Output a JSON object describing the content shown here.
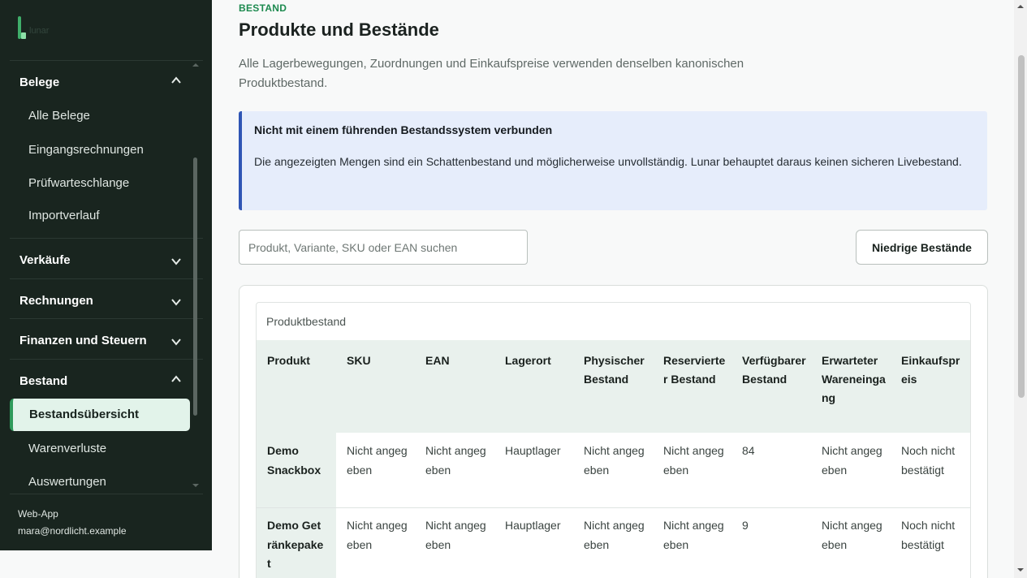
{
  "brand": {
    "name": "lunar",
    "icon": "lunar-logo-icon"
  },
  "sidebar": {
    "sections": [
      {
        "label": "Belege",
        "expanded": true,
        "items": [
          "Alle Belege",
          "Eingangsrechnungen",
          "Prüfwarteschlange",
          "Importverlauf"
        ]
      },
      {
        "label": "Verkäufe",
        "expanded": false
      },
      {
        "label": "Rechnungen",
        "expanded": false
      },
      {
        "label": "Finanzen und Steuern",
        "expanded": false
      },
      {
        "label": "Bestand",
        "expanded": true,
        "items": [
          "Bestandsübersicht",
          "Warenverluste",
          "Auswertungen"
        ]
      }
    ],
    "active_item": "Bestandsübersicht",
    "footer": {
      "app": "Web-App",
      "email": "mara@nordlicht.example"
    }
  },
  "page": {
    "eyebrow": "BESTAND",
    "title": "Produkte und Bestände",
    "lead": "Alle Lagerbewegungen, Zuordnungen und Einkaufspreise verwenden denselben kanonischen Produktbestand."
  },
  "notice": {
    "title": "Nicht mit einem führenden Bestandssystem verbunden",
    "body": "Die angezeigten Mengen sind ein Schattenbestand und möglicherweise unvollständig. Lunar behauptet daraus keinen sicheren Livebestand."
  },
  "search": {
    "placeholder": "Produkt, Variante, SKU oder EAN suchen",
    "value": ""
  },
  "low_stock_button": "Niedrige Bestände",
  "table": {
    "caption": "Produktbestand",
    "columns": [
      "Produkt",
      "SKU",
      "EAN",
      "Lagerort",
      "Physischer Bestand",
      "Reservierter Bestand",
      "Verfügbarer Bestand",
      "Erwarteter Wareneingang",
      "Einkaufspreis"
    ],
    "rows": [
      [
        "Demo Snackbox",
        "Nicht angegeben",
        "Nicht angegeben",
        "Hauptlager",
        "Nicht angegeben",
        "Nicht angegeben",
        "84",
        "Nicht angegeben",
        "Noch nicht bestätigt"
      ],
      [
        "Demo Getränkepaket",
        "Nicht angegeben",
        "Nicht angegeben",
        "Hauptlager",
        "Nicht angegeben",
        "Nicht angegeben",
        "9",
        "Nicht angegeben",
        "Noch nicht bestätigt"
      ]
    ]
  },
  "colors": {
    "sidebar_bg": "#19251f",
    "accent": "#2f9a5b",
    "notice_border": "#2f55b5",
    "notice_bg": "#e6edfb"
  }
}
